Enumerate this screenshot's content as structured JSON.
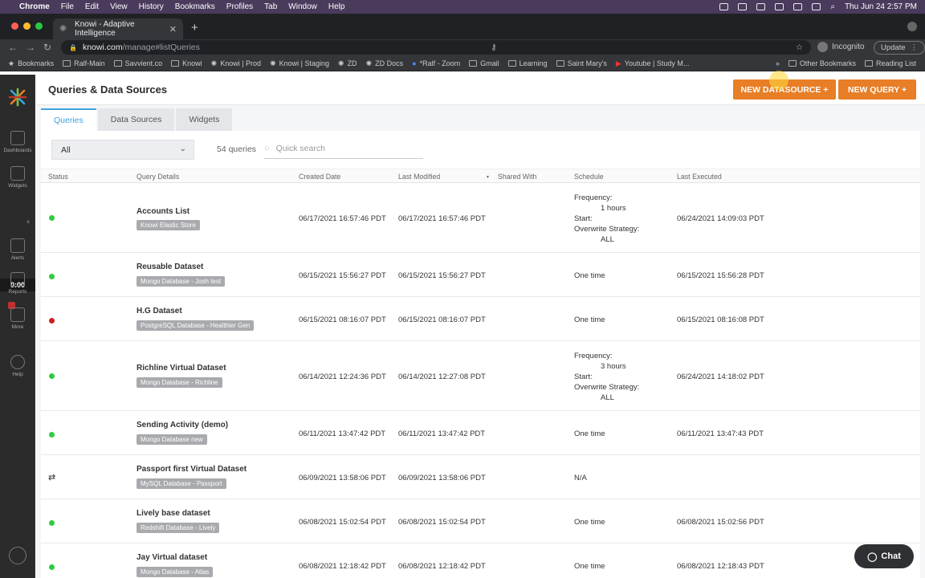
{
  "mac_menu": {
    "app": "Chrome",
    "items": [
      "File",
      "Edit",
      "View",
      "History",
      "Bookmarks",
      "Profiles",
      "Tab",
      "Window",
      "Help"
    ],
    "clock": "Thu Jun 24  2:57 PM"
  },
  "browser": {
    "tab_title": "Knowi - Adaptive Intelligence",
    "url_host": "knowi.com",
    "url_path": "/manage#listQueries",
    "profile_label": "Incognito",
    "update_label": "Update",
    "bookmarks": [
      "Bookmarks",
      "Ralf-Main",
      "Savvient.co",
      "Knowi",
      "Knowi | Prod",
      "Knowi | Staging",
      "ZD",
      "ZD Docs",
      "*Ralf - Zoom",
      "Gmail",
      "Learning",
      "Saint Mary's",
      "Youtube | Study M..."
    ],
    "bookmarks_more": "»",
    "other_bookmarks": "Other Bookmarks",
    "reading_list": "Reading List"
  },
  "sidebar": {
    "items": [
      "Dashboards",
      "Widgets",
      "Alerts",
      "Reports",
      "More",
      "Help"
    ],
    "timer": "0:00",
    "cut_label": "s"
  },
  "header": {
    "title": "Queries & Data Sources",
    "new_datasource": "NEW DATASOURCE +",
    "new_query": "NEW QUERY +"
  },
  "tabs": [
    "Queries",
    "Data Sources",
    "Widgets"
  ],
  "filters": {
    "select_value": "All",
    "count": "54 queries",
    "search_placeholder": "Quick search"
  },
  "table": {
    "columns": [
      "Status",
      "Query Details",
      "Created Date",
      "Last Modified",
      "Shared With",
      "Schedule",
      "Last Executed"
    ],
    "rows": [
      {
        "status": "green",
        "name": "Accounts List",
        "source": "Knowi Elastic Store",
        "created": "06/17/2021 16:57:46 PDT",
        "modified": "06/17/2021 16:57:46 PDT",
        "schedule_lines": [
          "Frequency:",
          "1 hours",
          "Start:",
          "Overwrite Strategy:",
          "ALL"
        ],
        "last_executed": "06/24/2021 14:09:03 PDT"
      },
      {
        "status": "green",
        "name": "Reusable Dataset",
        "source": "Mongo Database - Josh test",
        "created": "06/15/2021 15:56:27 PDT",
        "modified": "06/15/2021 15:56:27 PDT",
        "schedule": "One time",
        "last_executed": "06/15/2021 15:56:28 PDT"
      },
      {
        "status": "red",
        "name": "H.G Dataset",
        "source": "PostgreSQL Database - Healthier Gen",
        "created": "06/15/2021 08:16:07 PDT",
        "modified": "06/15/2021 08:16:07 PDT",
        "schedule": "One time",
        "last_executed": "06/15/2021 08:16:08 PDT"
      },
      {
        "status": "green",
        "name": "Richline Virtual Dataset",
        "source": "Mongo Database - Richline",
        "created": "06/14/2021 12:24:36 PDT",
        "modified": "06/14/2021 12:27:08 PDT",
        "schedule_lines": [
          "Frequency:",
          "3 hours",
          "Start:",
          "Overwrite Strategy:",
          "ALL"
        ],
        "last_executed": "06/24/2021 14:18:02 PDT"
      },
      {
        "status": "green",
        "name": "Sending Activity (demo)",
        "source": "Mongo Database new",
        "created": "06/11/2021 13:47:42 PDT",
        "modified": "06/11/2021 13:47:42 PDT",
        "schedule": "One time",
        "last_executed": "06/11/2021 13:47:43 PDT"
      },
      {
        "status": "sync",
        "name": "Passport first Virtual Dataset",
        "source": "MySQL Database - Passport",
        "created": "06/09/2021 13:58:06 PDT",
        "modified": "06/09/2021 13:58:06 PDT",
        "schedule": "N/A",
        "last_executed": ""
      },
      {
        "status": "green",
        "name": "Lively base dataset",
        "source": "Redshift Database - Lively",
        "created": "06/08/2021 15:02:54 PDT",
        "modified": "06/08/2021 15:02:54 PDT",
        "schedule": "One time",
        "last_executed": "06/08/2021 15:02:56 PDT"
      },
      {
        "status": "green",
        "name": "Jay Virtual dataset",
        "source": "Mongo Database - Atlas",
        "created": "06/08/2021 12:18:42 PDT",
        "modified": "06/08/2021 12:18:42 PDT",
        "schedule": "One time",
        "last_executed": "06/08/2021 12:18:43 PDT"
      }
    ]
  },
  "chat_label": "Chat",
  "colors": {
    "accent": "#e87e26",
    "tab_active": "#3ea3e0",
    "status_green": "#2ecc40",
    "status_red": "#cc1f1f"
  }
}
